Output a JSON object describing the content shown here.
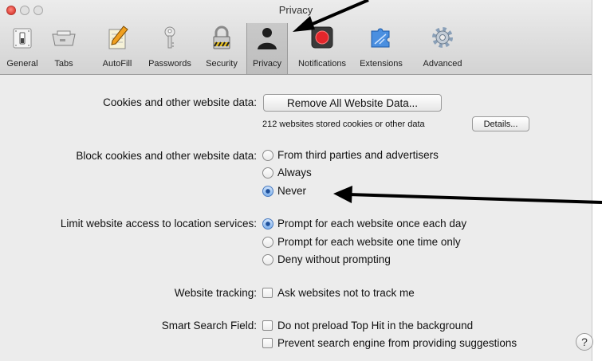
{
  "window": {
    "title": "Privacy"
  },
  "toolbar": {
    "items": [
      {
        "label": "General",
        "icon": "general-switch-icon"
      },
      {
        "label": "Tabs",
        "icon": "tabs-icon"
      },
      {
        "label": "AutoFill",
        "icon": "autofill-pencil-icon"
      },
      {
        "label": "Passwords",
        "icon": "key-icon"
      },
      {
        "label": "Security",
        "icon": "padlock-icon"
      },
      {
        "label": "Privacy",
        "icon": "person-silhouette-icon",
        "selected": true
      },
      {
        "label": "Notifications",
        "icon": "notifications-icon"
      },
      {
        "label": "Extensions",
        "icon": "puzzle-piece-icon"
      },
      {
        "label": "Advanced",
        "icon": "gear-icon"
      }
    ]
  },
  "cookies": {
    "label": "Cookies and other website data:",
    "remove_button": "Remove All Website Data...",
    "stored_text": "212 websites stored cookies or other data",
    "details_button": "Details..."
  },
  "block_cookies": {
    "label": "Block cookies and other website data:",
    "options": [
      {
        "label": "From third parties and advertisers",
        "selected": false
      },
      {
        "label": "Always",
        "selected": false
      },
      {
        "label": "Never",
        "selected": true
      }
    ]
  },
  "location": {
    "label": "Limit website access to location services:",
    "options": [
      {
        "label": "Prompt for each website once each day",
        "selected": true
      },
      {
        "label": "Prompt for each website one time only",
        "selected": false
      },
      {
        "label": "Deny without prompting",
        "selected": false
      }
    ]
  },
  "tracking": {
    "label": "Website tracking:",
    "checkbox": "Ask websites not to track me"
  },
  "smart_search": {
    "label": "Smart Search Field:",
    "checkboxes": [
      "Do not preload Top Hit in the background",
      "Prevent search engine from providing suggestions"
    ]
  },
  "help": {
    "label": "?"
  },
  "colors": {
    "accent": "#3a74c4",
    "close": "#e0443b",
    "arrow": "#000000"
  }
}
